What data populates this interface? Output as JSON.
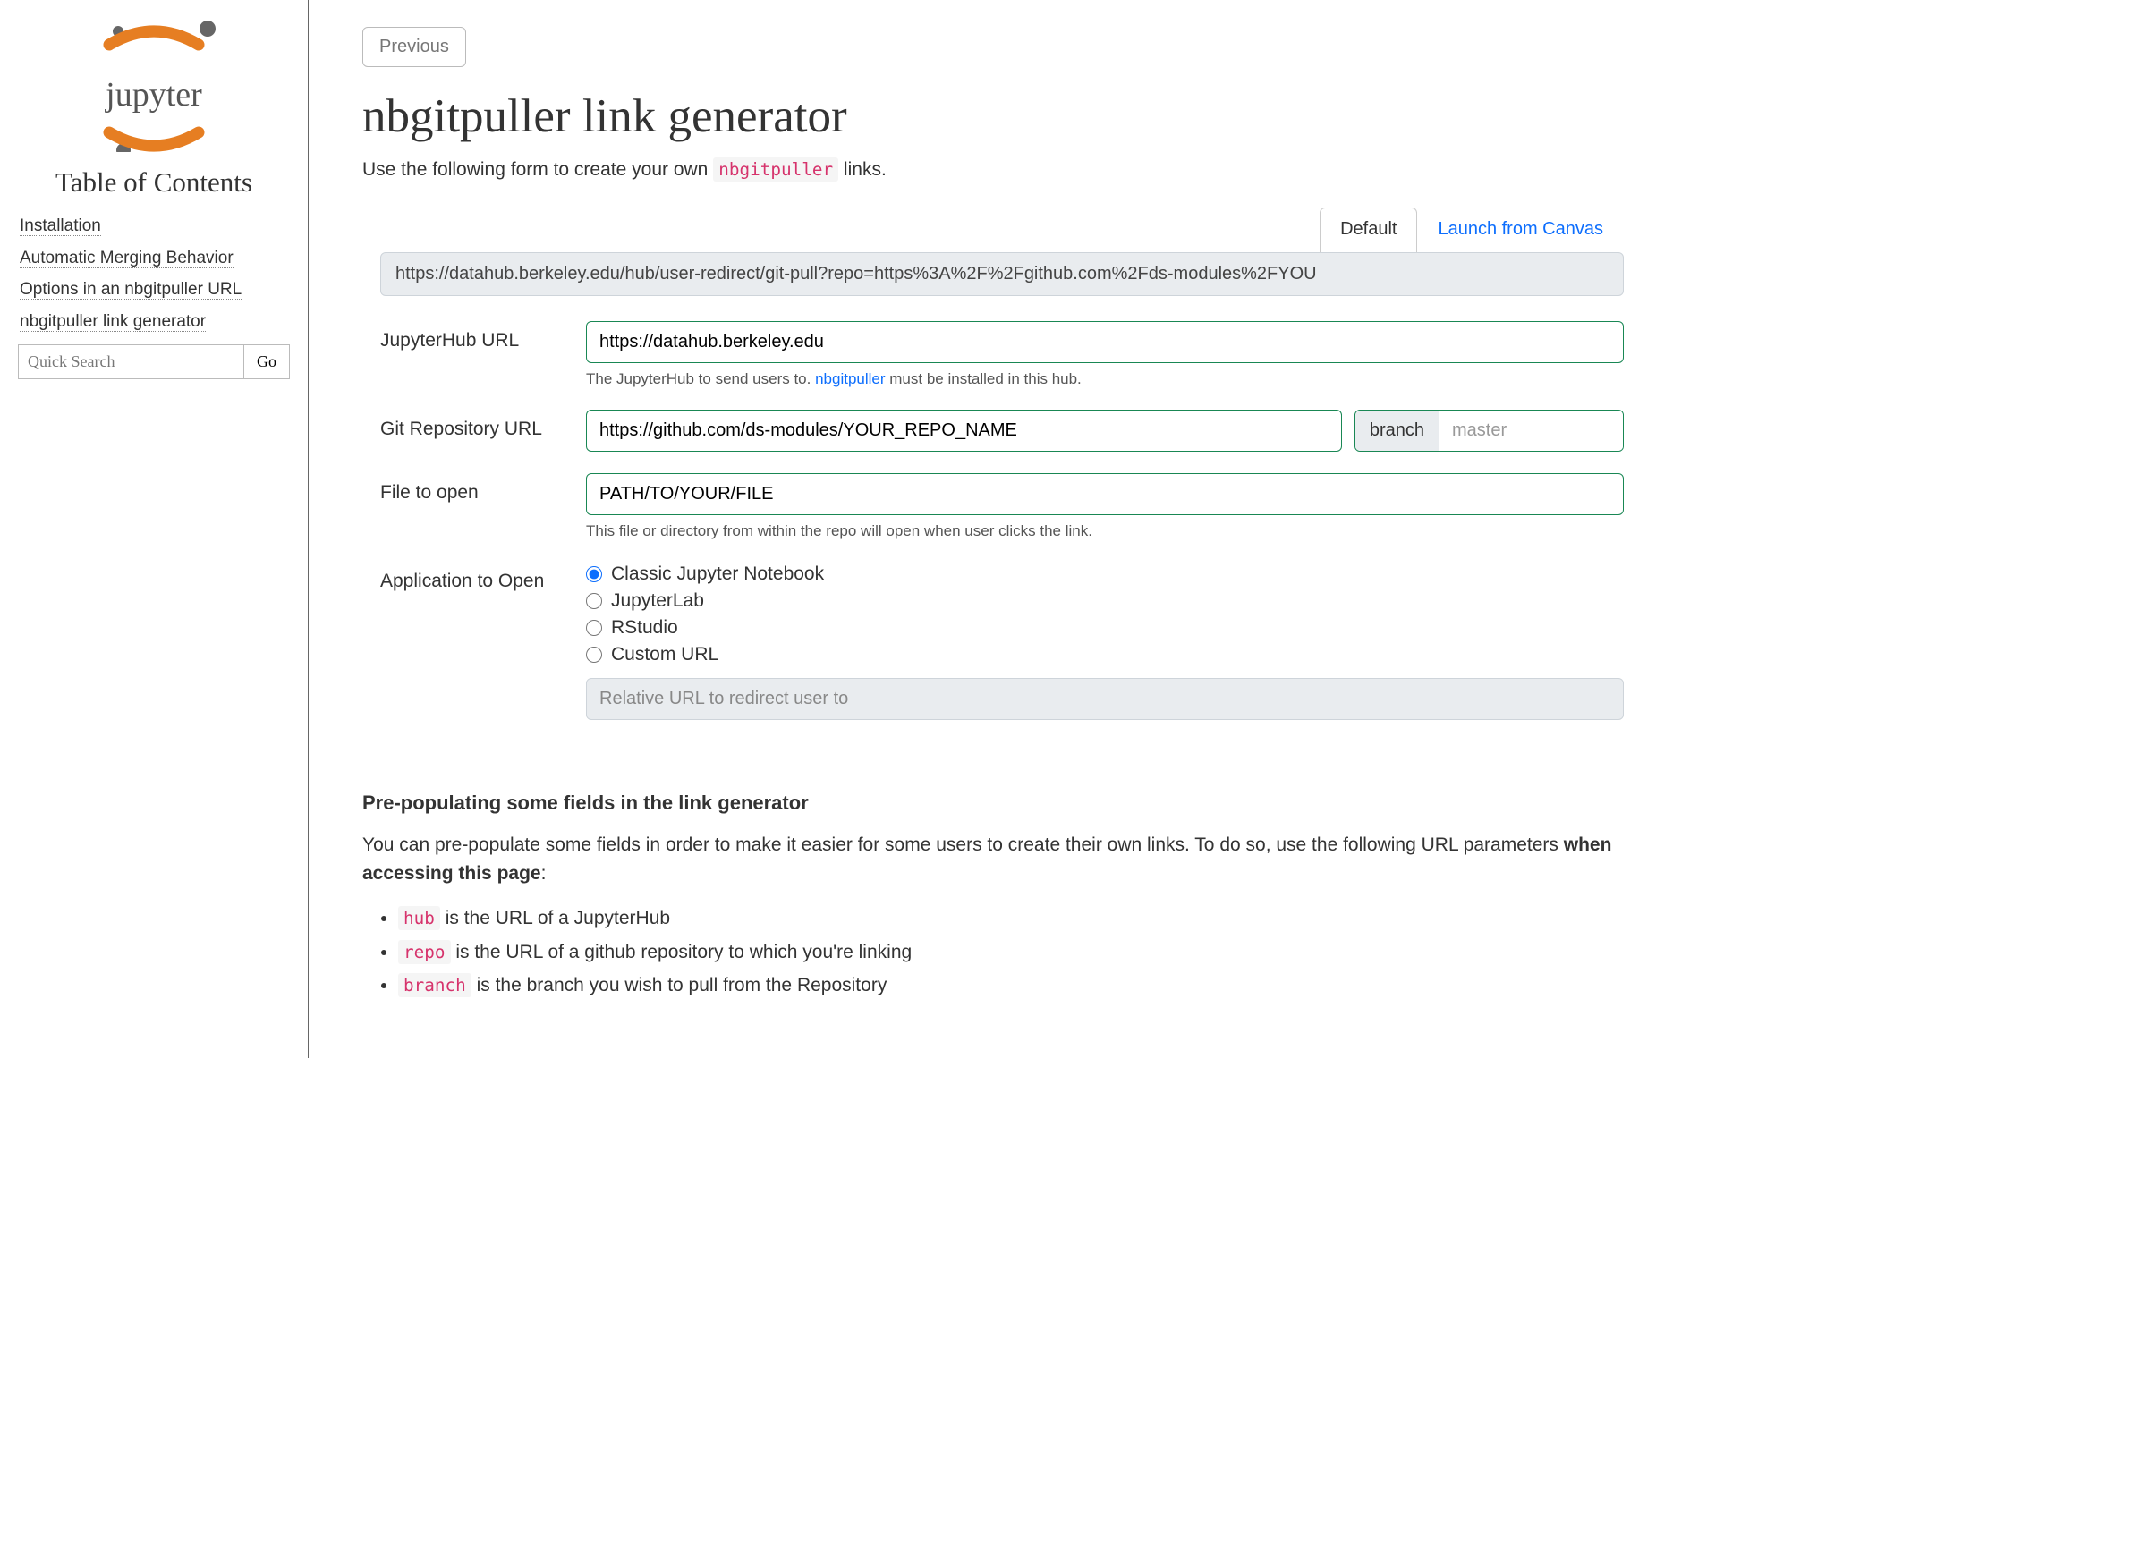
{
  "sidebar": {
    "toc_title": "Table of Contents",
    "items": [
      {
        "label": "Installation"
      },
      {
        "label": "Automatic Merging Behavior"
      },
      {
        "label": "Options in an nbgitpuller URL"
      },
      {
        "label": "nbgitpuller link generator"
      }
    ],
    "search_placeholder": "Quick Search",
    "go_label": "Go"
  },
  "header": {
    "prev_label": "Previous",
    "page_title": "nbgitpuller link generator",
    "intro_before": "Use the following form to create your own ",
    "intro_code": "nbgitpuller",
    "intro_after": " links."
  },
  "tabs": {
    "default": "Default",
    "canvas": "Launch from Canvas"
  },
  "url_output": "https://datahub.berkeley.edu/hub/user-redirect/git-pull?repo=https%3A%2F%2Fgithub.com%2Fds-modules%2FYOU",
  "form": {
    "hub_label": "JupyterHub URL",
    "hub_value": "https://datahub.berkeley.edu",
    "hub_help_before": "The JupyterHub to send users to. ",
    "hub_help_link": "nbgitpuller",
    "hub_help_after": " must be installed in this hub.",
    "repo_label": "Git Repository URL",
    "repo_value": "https://github.com/ds-modules/YOUR_REPO_NAME",
    "branch_label": "branch",
    "branch_placeholder": "master",
    "file_label": "File to open",
    "file_value": "PATH/TO/YOUR/FILE",
    "file_help": "This file or directory from within the repo will open when user clicks the link.",
    "app_label": "Application to Open",
    "app_options": {
      "classic": "Classic Jupyter Notebook",
      "lab": "JupyterLab",
      "rstudio": "RStudio",
      "custom": "Custom URL"
    },
    "custom_url_placeholder": "Relative URL to redirect user to"
  },
  "prepop": {
    "heading": "Pre-populating some fields in the link generator",
    "text_before": "You can pre-populate some fields in order to make it easier for some users to create their own links. To do so, use the fol­lowing URL parameters ",
    "text_strong": "when accessing this page",
    "text_after": ":",
    "items": [
      {
        "code": "hub",
        "text": " is the URL of a JupyterHub"
      },
      {
        "code": "repo",
        "text": " is the URL of a github repository to which you're linking"
      },
      {
        "code": "branch",
        "text": " is the branch you wish to pull from the Repository"
      }
    ]
  }
}
